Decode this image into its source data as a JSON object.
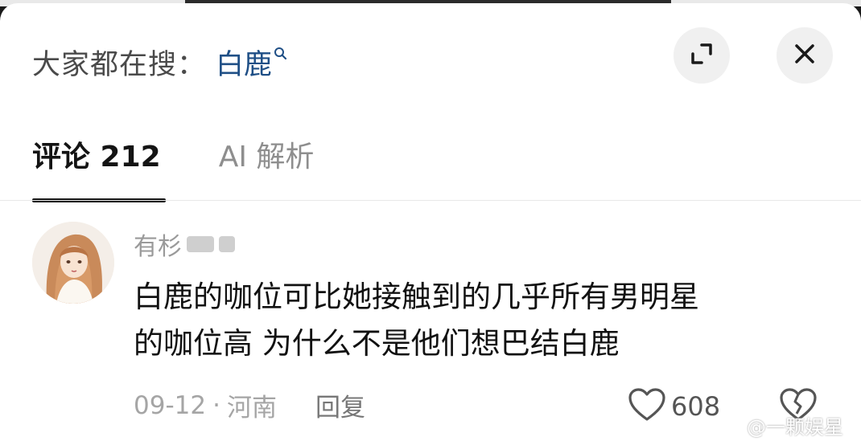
{
  "search": {
    "prefix": "大家都在搜：",
    "term": "白鹿"
  },
  "header_actions": {
    "expand_icon": "expand-icon",
    "close_icon": "close-icon"
  },
  "tabs": [
    {
      "label": "评论 212",
      "active": true
    },
    {
      "label": "AI 解析",
      "active": false
    }
  ],
  "comment": {
    "username": "有杉",
    "text_line1": "白鹿的咖位可比她接触到的几乎所有男明星",
    "text_line2": "的咖位高 为什么不是他们想巴结白鹿",
    "date": "09-12",
    "separator": "·",
    "location": "河南",
    "reply_label": "回复",
    "likes": "608"
  },
  "watermark": "@一颗娱星",
  "colors": {
    "search_term": "#1f4f86",
    "active_tab": "#141414",
    "muted_text": "#a5a5a5"
  }
}
